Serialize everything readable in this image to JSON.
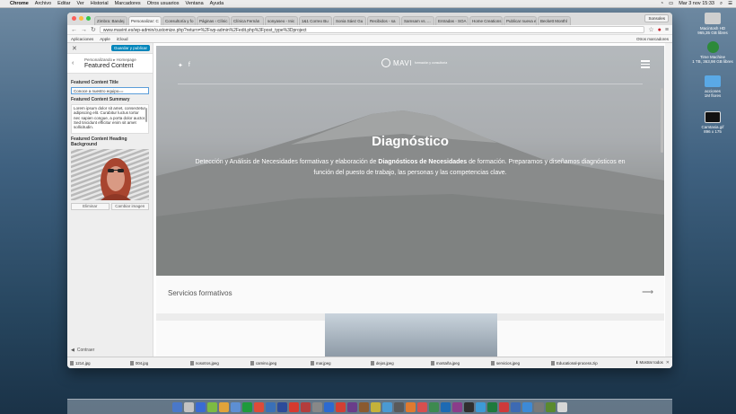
{
  "menubar": {
    "app": "Chrome",
    "items": [
      "Archivo",
      "Editar",
      "Ver",
      "Historial",
      "Marcadores",
      "Otros usuarios",
      "Ventana",
      "Ayuda"
    ],
    "clock": "Mar 3 nov 15:33"
  },
  "desktop": [
    {
      "label": "Macintosh HD\n965,35 GB libres",
      "color": "#cfcfcf"
    },
    {
      "label": "Time Machine\n1 TB, 363,98 GB libres",
      "color": "#2d8a3a"
    },
    {
      "label": "acciones\n1M flores",
      "color": "#5aa9e6"
    },
    {
      "label": "Camtasia.gif\n896 x 175",
      "color": "#111111"
    }
  ],
  "browser": {
    "tabs": [
      "Zimbra: Bandej",
      "Personalizar: C",
      "Consultoría y fo",
      "Páginas ‹ Clínic",
      "Clínica Fernán",
      "sonyaseo - Inic",
      "1&1 Correo Bu",
      "Sonia Sáez Gu",
      "Recibidos - sa",
      "Samsam vs. ...",
      "Entradas - SOA",
      "Home Creations",
      "Publicar nueva e",
      "Beckett Monthl"
    ],
    "active_tab": 1,
    "profile": "Sonsoles",
    "url": "www.mavint.es/wp-admin/customize.php?return=%2Fwp-admin%2Fedit.php%3Fpost_type%3Dproject",
    "bookmarks": [
      "Aplicaciones",
      "Apple",
      "iCloud"
    ],
    "other_bookmarks": "Otros marcadores"
  },
  "customizer": {
    "save_label": "Guardar y publicar",
    "breadcrumb": "Personalizando ▸ Homepage",
    "section_title": "Featured Content",
    "title_label": "Featured Content Title",
    "title_value": "Conoce a nuestro equipo==",
    "summary_label": "Featured Content Summary",
    "summary_value": "Lorem ipsum dolor sit amet, consectetur adipiscing elit. Curabitur luctus tortor nec sapien congue, a porta dolor auctor. Sed tincidunt efficitur enim sit amet sollicitudin.",
    "bg_label": "Featured Content Heading Background",
    "remove_label": "Eliminar",
    "change_label": "Cambiar imagen",
    "collapse_label": "Contraer"
  },
  "preview": {
    "logo_name": "MAVI",
    "logo_tag": "formación y consultoría",
    "hero_title": "Diagnóstico",
    "hero_text_before": "Detección y Análisis de Necesidades formativas y elaboración de ",
    "hero_text_bold": "Diagnósticos de Necesidades",
    "hero_text_after": " de formación. Preparamos y diseñamos diagnósticos en función del puesto de trabajo, las personas y las competencias clave.",
    "section_title": "Servicios formativos"
  },
  "downloads": {
    "items": [
      "1214.jpg",
      "004.jpg",
      "nosotros.jpeg",
      "camino.jpeg",
      "mar.jpeg",
      "dejos.jpeg",
      "montaña.jpeg",
      "servicios.jpeg",
      "Educational-process.zip"
    ],
    "show_all": "Mostrar todos"
  },
  "dock_colors": [
    "#4a78c8",
    "#c2c2c2",
    "#3a6bd3",
    "#7dbb43",
    "#e0a33a",
    "#5d8fd3",
    "#1f9a3c",
    "#dd4b39",
    "#3a70b7",
    "#2c4b9a",
    "#d63a2f",
    "#b33d3d",
    "#888888",
    "#2d6ad0",
    "#d33f33",
    "#6a3d8a",
    "#8a5a2f",
    "#c4b23a",
    "#4a9ad3",
    "#5a5a5a",
    "#e07a2f",
    "#d64f4f",
    "#3d8a4f",
    "#1d6ab3",
    "#8a3d8a",
    "#2f2f2f",
    "#3d9ad6",
    "#1e7a3c",
    "#cf3a3a",
    "#3d6ab3",
    "#3d8ad6",
    "#7a7a7a",
    "#5a8a2f",
    "#d6d6d6"
  ]
}
